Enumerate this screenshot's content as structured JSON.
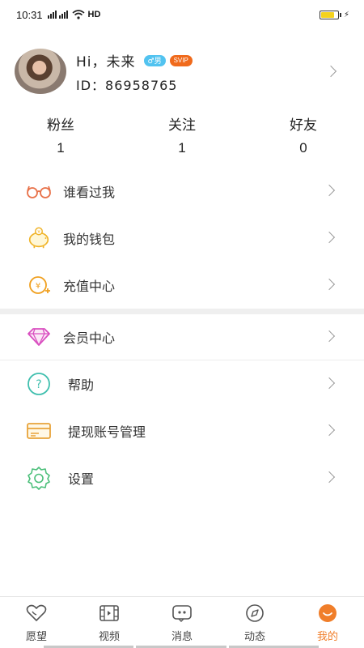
{
  "status_bar": {
    "time": "10:31",
    "network": "HD"
  },
  "profile": {
    "greeting": "Hi，未来",
    "gender_badge": "♂男",
    "vip_badge": "SVIP",
    "user_id": "ID：86958765"
  },
  "stats": [
    {
      "label": "粉丝",
      "value": "1"
    },
    {
      "label": "关注",
      "value": "1"
    },
    {
      "label": "好友",
      "value": "0"
    }
  ],
  "menu": {
    "visitors": "谁看过我",
    "wallet": "我的钱包",
    "recharge": "充值中心",
    "membership": "会员中心",
    "help": "帮助",
    "withdraw_account": "提现账号管理",
    "settings": "设置"
  },
  "tabs": [
    {
      "label": "愿望",
      "icon": "heart-icon"
    },
    {
      "label": "视频",
      "icon": "film-icon"
    },
    {
      "label": "消息",
      "icon": "chat-icon"
    },
    {
      "label": "动态",
      "icon": "compass-icon"
    },
    {
      "label": "我的",
      "icon": "smile-icon",
      "active": true
    }
  ],
  "colors": {
    "accent": "#f07e2a",
    "gender_badge": "#52c3f0",
    "vip_badge": "#f06a1c",
    "battery": "#f4d21e"
  }
}
